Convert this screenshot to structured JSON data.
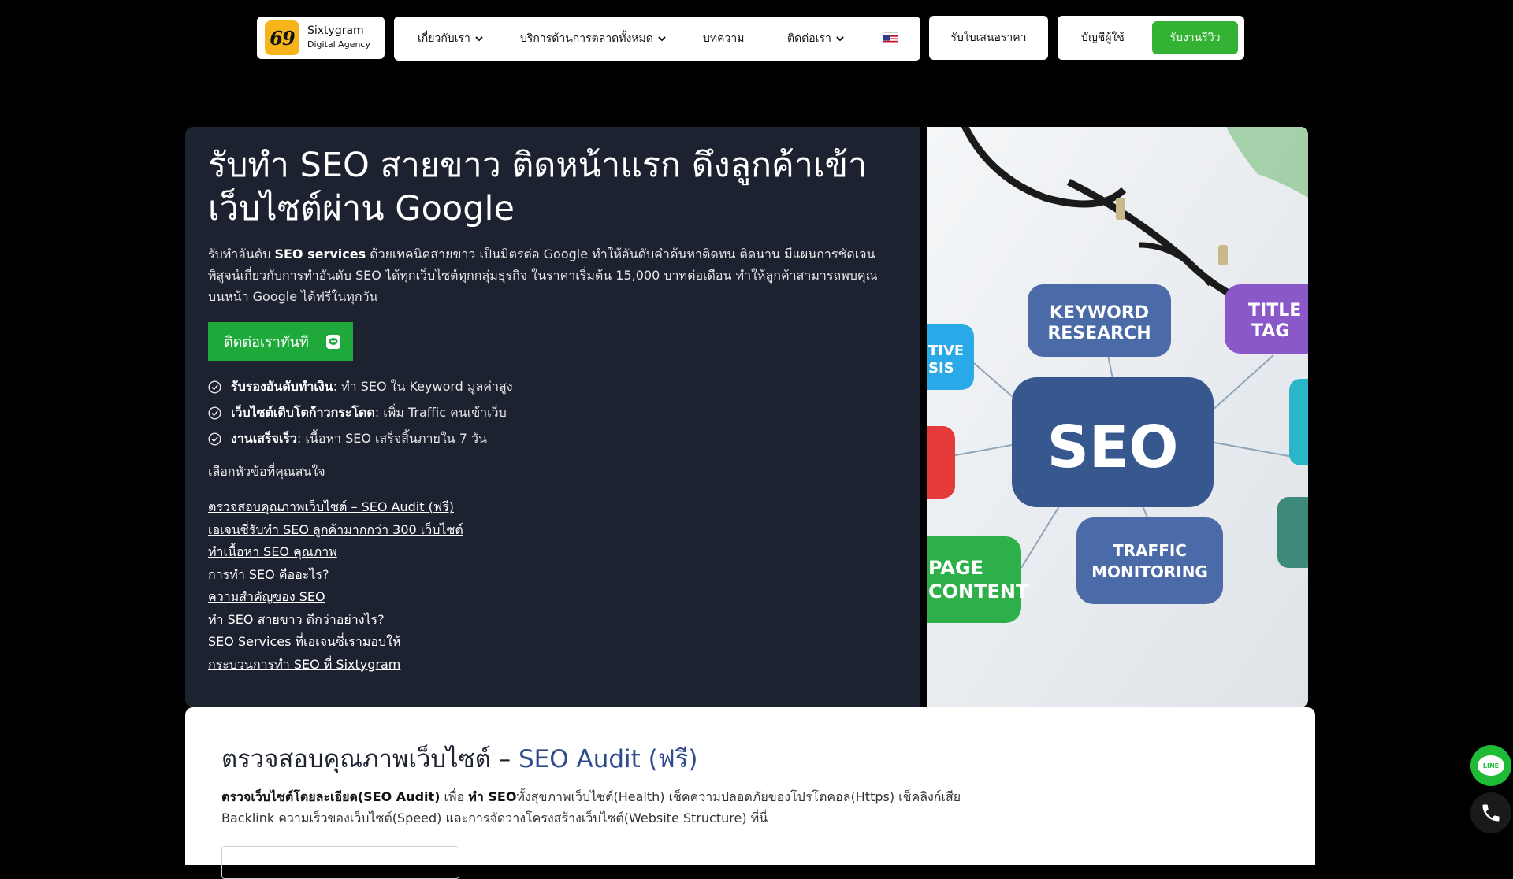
{
  "logo": {
    "mark": "69",
    "name": "Sixtygram",
    "tagline": "Digital Agency"
  },
  "nav": {
    "items": [
      {
        "label": "เกี่ยวกับเรา",
        "dropdown": true
      },
      {
        "label": "บริการด้านการตลาดทั้งหมด",
        "dropdown": true
      },
      {
        "label": "บทความ",
        "dropdown": false
      },
      {
        "label": "ติดต่อเรา",
        "dropdown": true
      }
    ],
    "language_icon": "us-flag-icon",
    "quote_button": "รับใบเสนอราคา",
    "account_link": "บัญชีผู้ใช้",
    "review_button": "รับงานรีวิว",
    "review_color": "#34b233"
  },
  "hero": {
    "title": "รับทำ SEO สายขาว ติดหน้าแรก ดึงลูกค้าเข้าเว็บไซต์ผ่าน Google",
    "desc_pre": "รับทำอันดับ ",
    "desc_bold": "SEO services",
    "desc_post": " ด้วยเทคนิคสายขาว เป็นมิตรต่อ Google ทำให้อันดับคำค้นหาติดทน ติดนาน มีแผนการชัดเจน พิสูจน์เกี่ยวกับการทำอันดับ SEO ได้ทุกเว็บไซต์ทุกกลุ่มธุรกิจ ในราคาเริ่มต้น 15,000 บาทต่อเดือน ทำให้ลูกค้าสามารถพบคุณบนหน้า Google ได้ฟรีในทุกวัน",
    "cta_label": "ติดต่อเราทันที",
    "cta_color": "#1fa93a",
    "checks": [
      {
        "bold": "รับรองอันดับทำเงิน",
        "text": ": ทำ SEO ใน Keyword มูลค่าสูง"
      },
      {
        "bold": "เว็บไซต์เติบโตก้าวกระโดด",
        "text": ": เพิ่ม Traffic คนเข้าเว็บ"
      },
      {
        "bold": "งานเสร็จเร็ว",
        "text": ": เนื้อหา SEO เสร็จสิ้นภายใน 7 วัน"
      }
    ],
    "topics_label": "เลือกหัวข้อที่คุณสนใจ",
    "topics": [
      "ตรวจสอบคุณภาพเว็บไซต์ – SEO Audit (ฟรี)",
      "เอเจนซี่รับทำ SEO ลูกค้ามากกว่า 300 เว็บไซต์",
      "ทำเนื้อหา SEO คุณภาพ",
      "การทำ SEO คืออะไร?",
      "ความสำคัญของ SEO",
      "ทำ SEO สายขาว ดีกว่าอย่างไร?",
      "SEO Services ที่เอเจนซี่เรามอบให้",
      "กระบวนการทำ SEO ที่ Sixtygram"
    ]
  },
  "hero_image": {
    "labels": {
      "keyword": [
        "KEYWORD",
        "RESEARCH"
      ],
      "title_tag": [
        "TITLE",
        "TAG"
      ],
      "seo": "SEO",
      "traffic": [
        "TRAFFIC",
        "MONITORING"
      ],
      "content": [
        "PAGE",
        "CONTENT"
      ],
      "analysis": [
        "TIVE",
        "SIS"
      ]
    }
  },
  "section": {
    "title_main": "ตรวจสอบคุณภาพเว็บไซต์ – ",
    "title_accent": "SEO Audit (ฟรี)",
    "desc_bold1": "ตรวจเว็บไซต์โดยละเอียด(SEO Audit)",
    "desc_mid": " เพื่อ ",
    "desc_bold2": "ทำ SEO",
    "desc_rest": "ทั้งสุขภาพเว็บไซต์(Health) เช็คความปลอดภัยของโปรโตคอล(Https) เช็คลิงก์เสีย Backlink ความเร็วของเว็บไซต์(Speed) และการจัดวางโครงสร้างเว็บไซต์(Website Structure) ที่นี่"
  },
  "floating": {
    "line_label": "LINE",
    "line_color": "#1fbb36"
  }
}
